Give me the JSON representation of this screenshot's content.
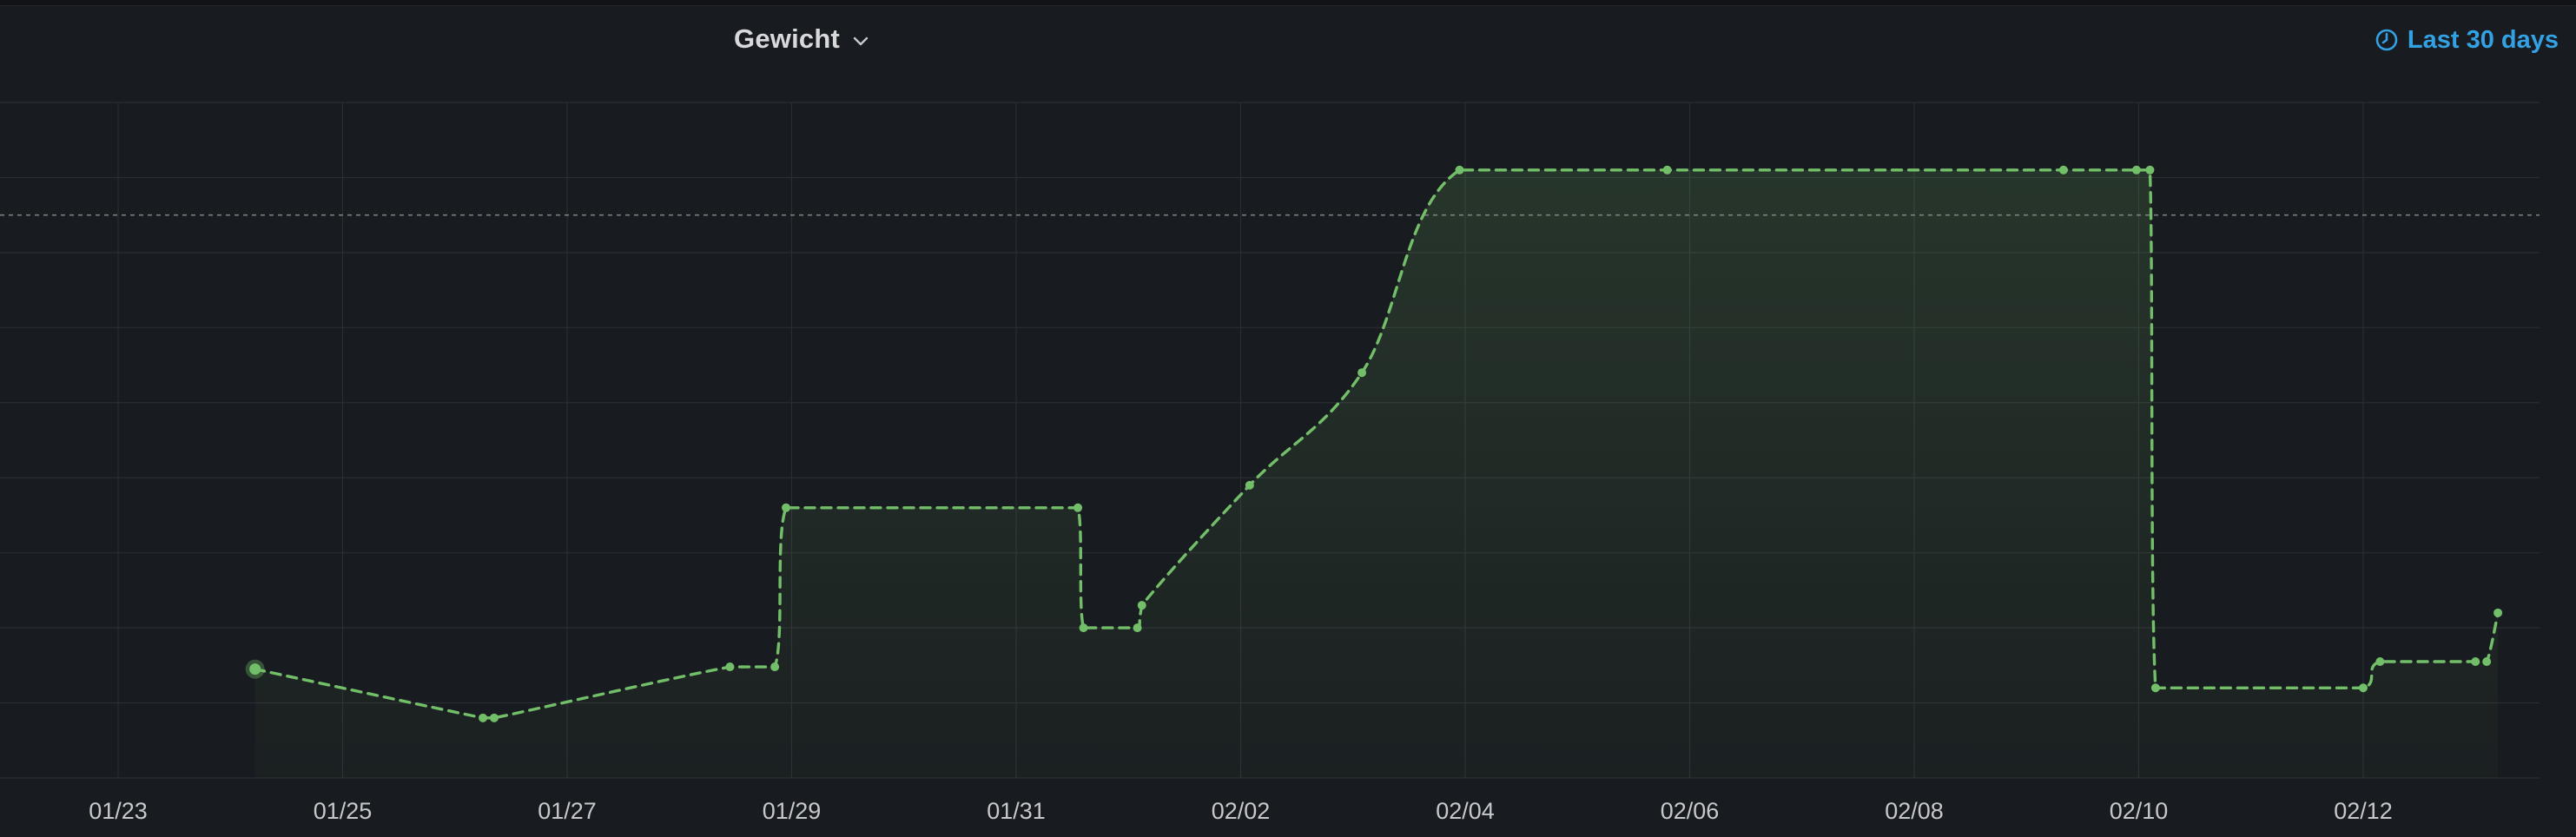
{
  "panel": {
    "title": "Gewicht",
    "time_range_label": "Last 30 days"
  },
  "icons": {
    "title_dropdown": "chevron-down-icon",
    "time_range": "clock-icon"
  },
  "colors": {
    "background": "#181b1f",
    "series": "#73bf69",
    "grid": "#2a2d33",
    "tick_text": "#c7c8cc",
    "time_range": "#33a2e5",
    "threshold": "#8e8e8e"
  },
  "chart_data": {
    "type": "line",
    "title": "Gewicht",
    "xlabel": "",
    "ylabel": "",
    "x_ticks": [
      "01/23",
      "01/25",
      "01/27",
      "01/29",
      "01/31",
      "02/02",
      "02/04",
      "02/06",
      "02/08",
      "02/10",
      "02/12"
    ],
    "x_range_days": [
      -0.45,
      21.2
    ],
    "y_range": [
      0,
      9
    ],
    "y_gridlines": 9,
    "y_tick_labels_visible": false,
    "threshold": 7.5,
    "grid": true,
    "legend": "none",
    "series": [
      {
        "color": "#73bf69",
        "line_style": "dashed",
        "fill": "gradient",
        "points": [
          {
            "x": 1.22,
            "y": 1.45,
            "highlighted": true
          },
          {
            "x": 3.25,
            "y": 0.8
          },
          {
            "x": 3.35,
            "y": 0.8
          },
          {
            "x": 5.45,
            "y": 1.48
          },
          {
            "x": 5.85,
            "y": 1.48
          },
          {
            "x": 5.95,
            "y": 3.6
          },
          {
            "x": 8.55,
            "y": 3.6
          },
          {
            "x": 8.6,
            "y": 2.0
          },
          {
            "x": 9.08,
            "y": 2.0
          },
          {
            "x": 9.12,
            "y": 2.3
          },
          {
            "x": 10.08,
            "y": 3.9
          },
          {
            "x": 11.08,
            "y": 5.4
          },
          {
            "x": 11.95,
            "y": 8.1
          },
          {
            "x": 13.8,
            "y": 8.1
          },
          {
            "x": 17.33,
            "y": 8.1
          },
          {
            "x": 17.98,
            "y": 8.1
          },
          {
            "x": 18.1,
            "y": 8.1
          },
          {
            "x": 18.15,
            "y": 1.2
          },
          {
            "x": 20.0,
            "y": 1.2
          },
          {
            "x": 20.15,
            "y": 1.55
          },
          {
            "x": 21.0,
            "y": 1.55
          },
          {
            "x": 21.1,
            "y": 1.55
          },
          {
            "x": 21.2,
            "y": 2.2
          }
        ]
      }
    ]
  }
}
